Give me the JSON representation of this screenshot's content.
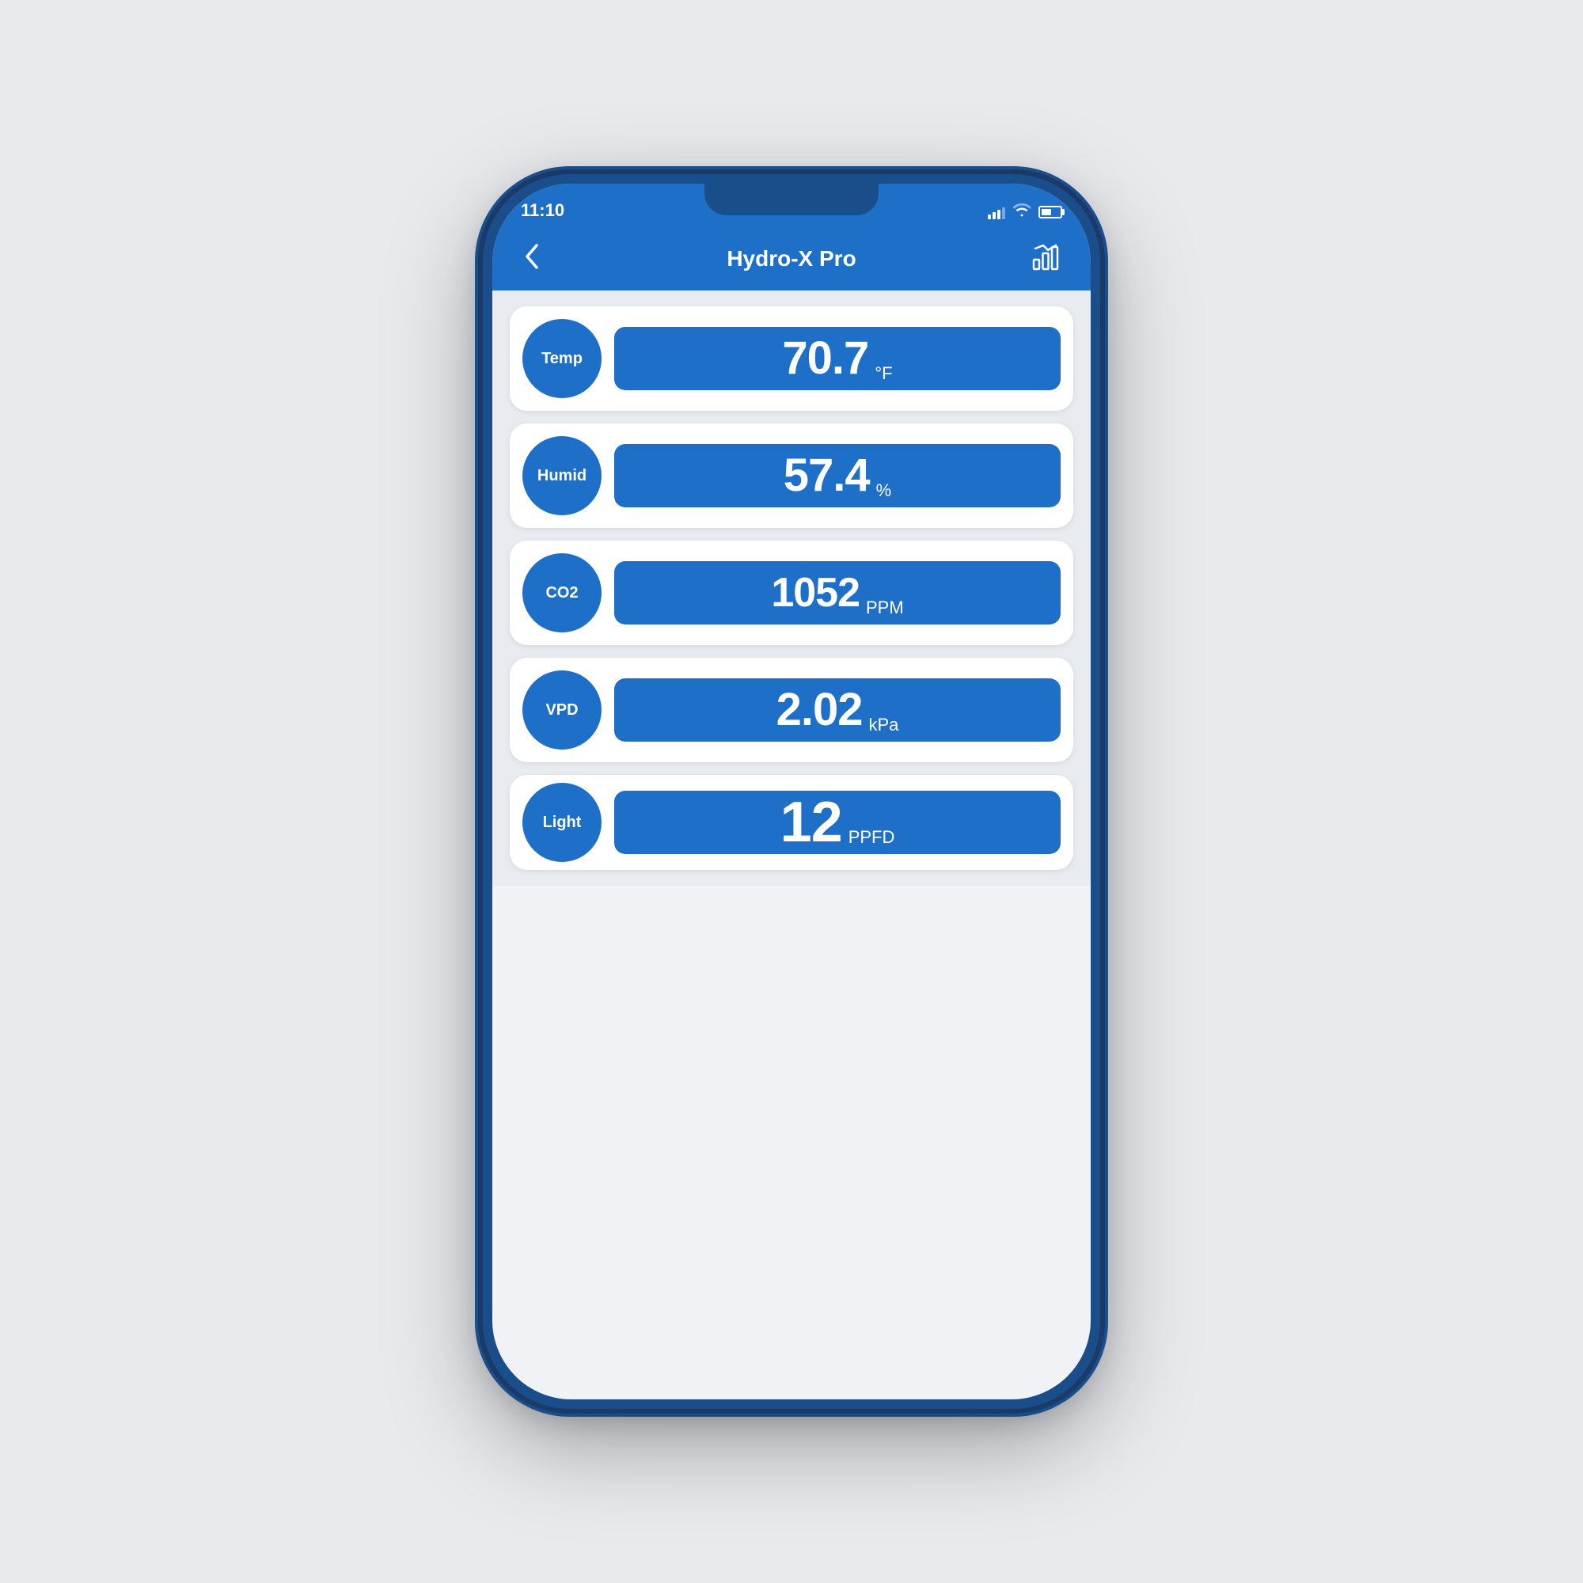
{
  "background": "#e8eaed",
  "phone": {
    "status_bar": {
      "time": "11:10",
      "signal": [
        3,
        6,
        9,
        12,
        15
      ],
      "wifi": "wifi",
      "battery_level": 55
    },
    "nav": {
      "back_label": "<",
      "title": "Hydro-X Pro",
      "chart_button": "chart-icon"
    },
    "sensors": [
      {
        "id": "temp",
        "label": "Temp",
        "value": "70.7",
        "unit": "°F"
      },
      {
        "id": "humid",
        "label": "Humid",
        "value": "57.4",
        "unit": "%"
      },
      {
        "id": "co2",
        "label": "CO2",
        "value": "1052",
        "unit": "PPM"
      },
      {
        "id": "vpd",
        "label": "VPD",
        "value": "2.02",
        "unit": "kPa"
      },
      {
        "id": "light",
        "label": "Light",
        "value": "12",
        "unit": "PPFD"
      }
    ],
    "colors": {
      "primary": "#1e6fc8",
      "phone_body": "#1a4e8a",
      "screen_bg": "#e8ecf0",
      "card_bg": "#ffffff"
    }
  }
}
